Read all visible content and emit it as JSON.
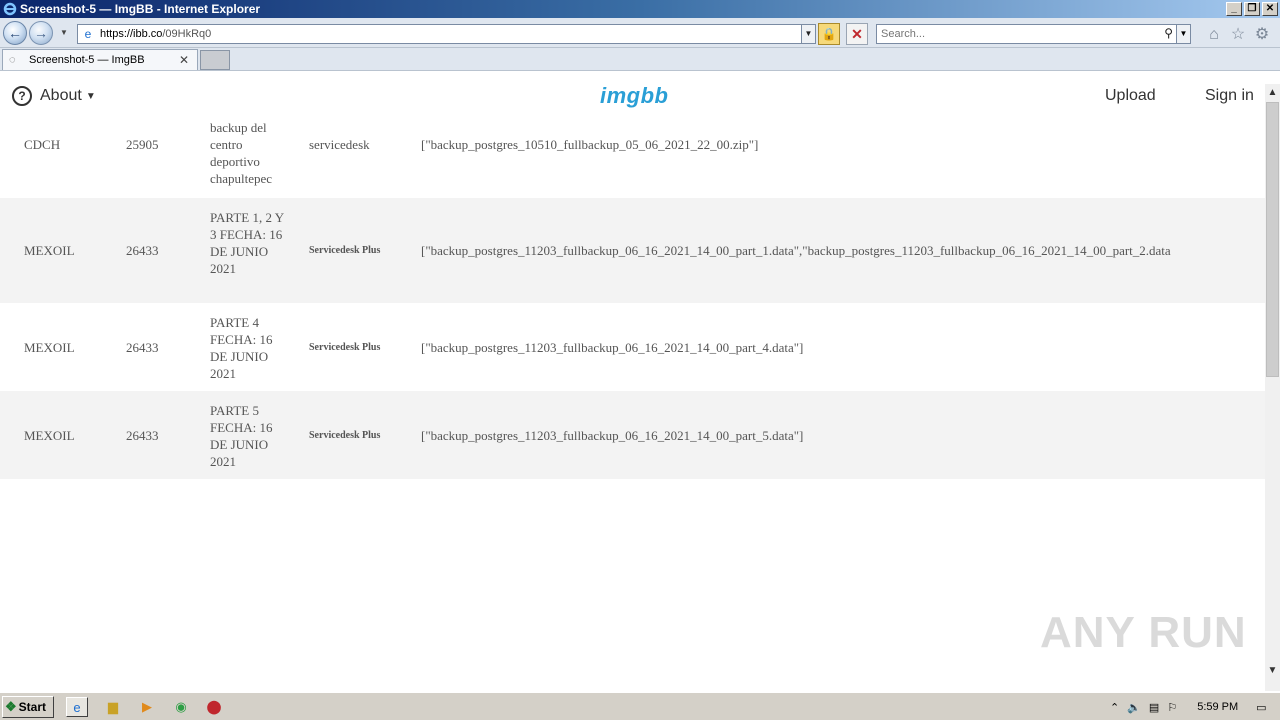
{
  "window": {
    "title": "Screenshot-5 — ImgBB - Internet Explorer"
  },
  "addressbar": {
    "url_host": "https://ibb.co",
    "url_path": "/09HkRq0",
    "search_placeholder": "Search..."
  },
  "tabs": [
    {
      "label": "Screenshot-5 — ImgBB"
    }
  ],
  "site": {
    "about_label": "About",
    "logo": "imgbb",
    "upload_label": "Upload",
    "signin_label": "Sign in"
  },
  "table_rows": [
    {
      "c1": "CDCH",
      "c2": "25905",
      "c3": "backup del centro deportivo chapultepec",
      "c4": "servicedesk",
      "c5": "[\"backup_postgres_10510_fullbackup_05_06_2021_22_00.zip\"]"
    },
    {
      "c1": "MEXOIL",
      "c2": "26433",
      "c3": "PARTE 1, 2 Y 3 FECHA: 16 DE JUNIO 2021",
      "c4": "Servicedesk Plus",
      "c5": "[\"backup_postgres_11203_fullbackup_06_16_2021_14_00_part_1.data\",\"backup_postgres_11203_fullbackup_06_16_2021_14_00_part_2.data"
    },
    {
      "c1": "MEXOIL",
      "c2": "26433",
      "c3": "PARTE 4 FECHA: 16 DE JUNIO 2021",
      "c4": "Servicedesk Plus",
      "c5": "[\"backup_postgres_11203_fullbackup_06_16_2021_14_00_part_4.data\"]"
    },
    {
      "c1": "MEXOIL",
      "c2": "26433",
      "c3": "PARTE 5 FECHA: 16 DE JUNIO 2021",
      "c4": "Servicedesk Plus",
      "c5": "[\"backup_postgres_11203_fullbackup_06_16_2021_14_00_part_5.data\"]"
    }
  ],
  "watermark": "ANY RUN",
  "taskbar": {
    "start_label": "Start",
    "clock": "5:59 PM"
  }
}
